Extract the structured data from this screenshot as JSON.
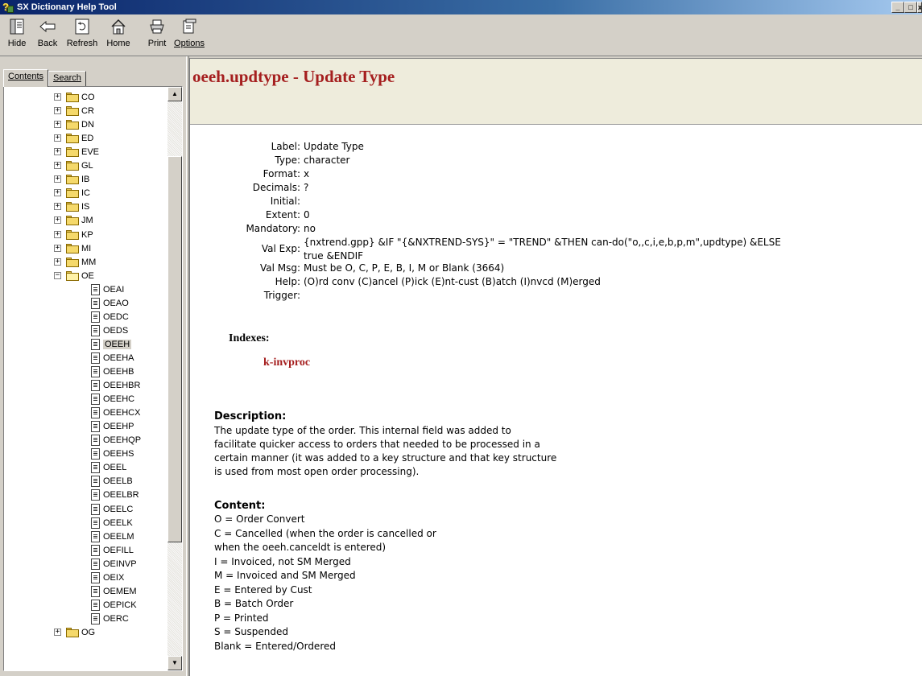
{
  "window": {
    "title": "SX Dictionary Help Tool",
    "controls": [
      "_",
      "□",
      "x"
    ]
  },
  "toolbar": {
    "buttons": [
      {
        "label": "Hide",
        "icon": "hide-icon"
      },
      {
        "label": "Back",
        "icon": "back-arrow-icon"
      },
      {
        "label": "Refresh",
        "icon": "refresh-icon"
      },
      {
        "label": "Home",
        "icon": "home-icon"
      },
      {
        "label": "Print",
        "icon": "printer-icon"
      },
      {
        "label": "Options",
        "icon": "options-icon"
      }
    ]
  },
  "tabs": {
    "contents": "Contents",
    "search": "Search"
  },
  "tree": {
    "folders_collapsed": [
      "CO",
      "CR",
      "DN",
      "ED",
      "EVE",
      "GL",
      "IB",
      "IC",
      "IS",
      "JM",
      "KP",
      "MI",
      "MM"
    ],
    "open_folder": "OE",
    "children": [
      "OEAI",
      "OEAO",
      "OEDC",
      "OEDS",
      "OEEH",
      "OEEHA",
      "OEEHB",
      "OEEHBR",
      "OEEHC",
      "OEEHCX",
      "OEEHP",
      "OEEHQP",
      "OEEHS",
      "OEEL",
      "OEELB",
      "OEELBR",
      "OEELC",
      "OEELK",
      "OEELM",
      "OEFILL",
      "OEINVP",
      "OEIX",
      "OEMEM",
      "OEPICK",
      "OERC"
    ],
    "selected": "OEEH",
    "next_folder": "OG"
  },
  "page": {
    "title": "oeeh.updtype - Update Type",
    "fields": [
      {
        "label": "Label:",
        "value": "Update Type"
      },
      {
        "label": "Type:",
        "value": "character"
      },
      {
        "label": "Format:",
        "value": "x"
      },
      {
        "label": "Decimals:",
        "value": "?"
      },
      {
        "label": "Initial:",
        "value": ""
      },
      {
        "label": "Extent:",
        "value": "0"
      },
      {
        "label": "Mandatory:",
        "value": "no"
      },
      {
        "label": "Val Exp:",
        "value": "{nxtrend.gpp} &IF \"{&NXTREND-SYS}\" = \"TREND\" &THEN can-do(\"o,,c,i,e,b,p,m\",updtype) &ELSE",
        "value2": "true &ENDIF"
      },
      {
        "label": "Val Msg:",
        "value": "Must be O, C, P, E, B, I, M or Blank (3664)"
      },
      {
        "label": "Help:",
        "value": "(O)rd conv (C)ancel (P)ick (E)nt-cust (B)atch (I)nvcd (M)erged"
      },
      {
        "label": "Trigger:",
        "value": ""
      }
    ],
    "indexes_heading": "Indexes:",
    "index": "k-invproc",
    "description_heading": "Description:",
    "description_lines": [
      "The update type of the order. This internal field was added to",
      "facilitate quicker access to orders that needed to be processed in a",
      "certain manner (it was added to a key structure and that key structure",
      "is used from most open order processing)."
    ],
    "content_heading": "Content:",
    "content_lines": [
      "O = Order Convert",
      "C = Cancelled (when the order is cancelled or",
      "when the oeeh.canceldt is entered)",
      "I = Invoiced, not SM Merged",
      "M = Invoiced and SM Merged",
      "E = Entered by Cust",
      "B = Batch Order",
      "P = Printed",
      "S = Suspended",
      "Blank = Entered/Ordered"
    ]
  },
  "colors": {
    "title_red": "#a51f1f",
    "header_bg": "#eeecdc",
    "chrome": "#d4d0c8"
  }
}
